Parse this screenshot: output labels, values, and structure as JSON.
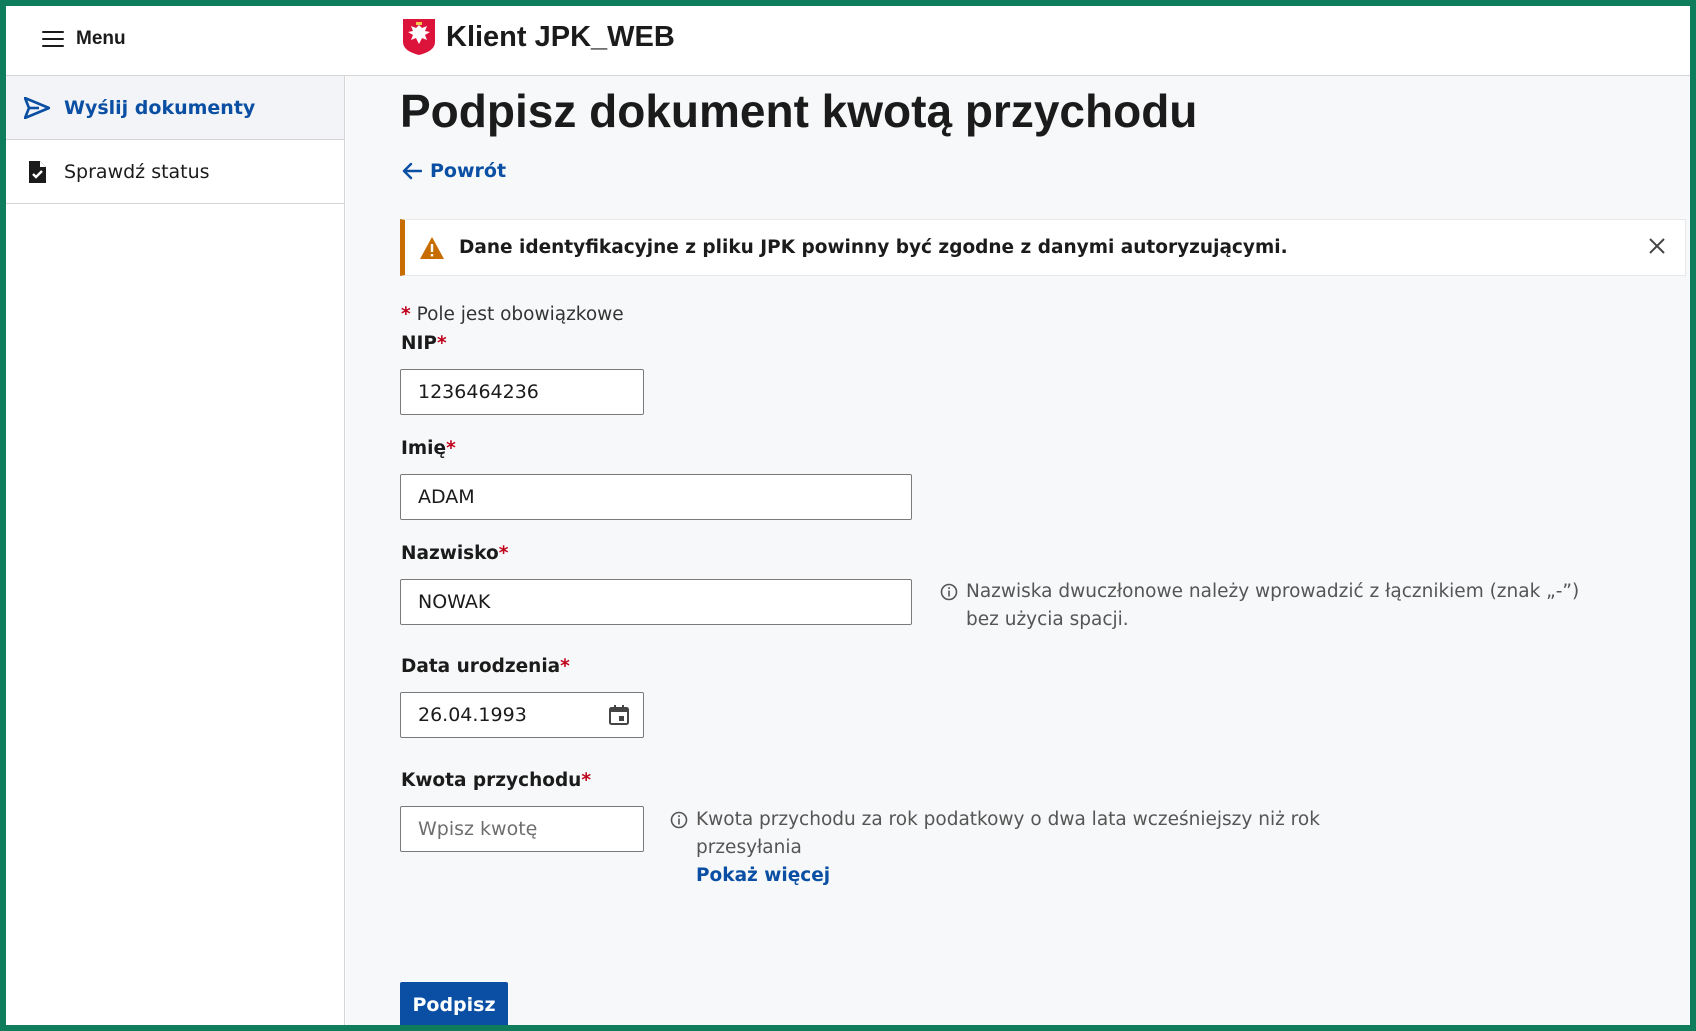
{
  "header": {
    "menu_label": "Menu",
    "app_title": "Klient JPK_WEB"
  },
  "sidebar": {
    "items": [
      {
        "label": "Wyślij dokumenty",
        "icon": "send-icon",
        "active": true
      },
      {
        "label": "Sprawdź status",
        "icon": "document-check-icon",
        "active": false
      }
    ]
  },
  "main": {
    "title": "Podpisz dokument kwotą przychodu",
    "back_label": "Powrót",
    "alert": {
      "text": "Dane identyfikacyjne z pliku JPK powinny być zgodne z danymi autoryzującymi.",
      "icon": "warning-icon"
    },
    "required_note": "Pole jest obowiązkowe",
    "fields": {
      "nip": {
        "label": "NIP",
        "value": "1236464236"
      },
      "first_name": {
        "label": "Imię",
        "value": "ADAM"
      },
      "last_name": {
        "label": "Nazwisko",
        "value": "NOWAK",
        "hint": "Nazwiska dwuczłonowe należy wprowadzić z łącznikiem (znak „-”) bez użycia spacji."
      },
      "birth_date": {
        "label": "Data urodzenia",
        "value": "26.04.1993"
      },
      "income": {
        "label": "Kwota przychodu",
        "placeholder": "Wpisz kwotę",
        "hint": "Kwota przychodu za rok podatkowy o dwa lata wcześniejszy niż rok przesyłania",
        "more_link": "Pokaż więcej"
      }
    },
    "submit_label": "Podpisz"
  },
  "colors": {
    "frame": "#0f7d5c",
    "link": "#0a4fa3",
    "warning": "#c76d00",
    "required": "#c0001a"
  }
}
